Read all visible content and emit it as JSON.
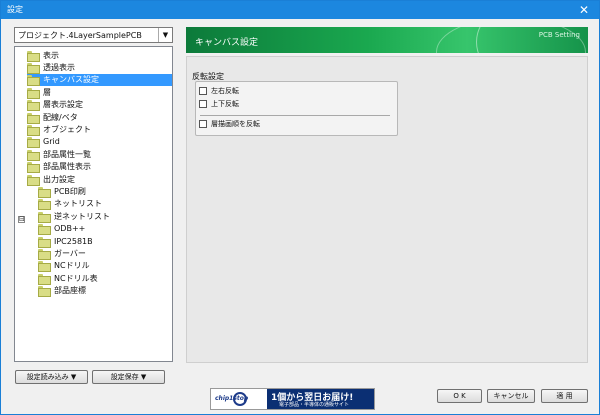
{
  "window": {
    "title": "設定",
    "close_glyph": "✕"
  },
  "project_combo": {
    "value": "プロジェクト.4LayerSamplePCB",
    "arrow": "▼"
  },
  "tree": {
    "expander_glyph": "⊟",
    "items": [
      {
        "label": "表示",
        "level": 0
      },
      {
        "label": "透過表示",
        "level": 0
      },
      {
        "label": "キャンバス設定",
        "level": 0,
        "selected": true
      },
      {
        "label": "層",
        "level": 0
      },
      {
        "label": "層表示設定",
        "level": 0
      },
      {
        "label": "配線/ベタ",
        "level": 0
      },
      {
        "label": "オブジェクト",
        "level": 0
      },
      {
        "label": "Grid",
        "level": 0
      },
      {
        "label": "部品属性一覧",
        "level": 0
      },
      {
        "label": "部品属性表示",
        "level": 0
      },
      {
        "label": "出力設定",
        "level": 0,
        "expanded": true
      },
      {
        "label": "PCB印刷",
        "level": 1
      },
      {
        "label": "ネットリスト",
        "level": 1
      },
      {
        "label": "逆ネットリスト",
        "level": 1
      },
      {
        "label": "ODB++",
        "level": 1
      },
      {
        "label": "IPC2581B",
        "level": 1
      },
      {
        "label": "ガーバー",
        "level": 1
      },
      {
        "label": "NCドリル",
        "level": 1
      },
      {
        "label": "NCドリル表",
        "level": 1
      },
      {
        "label": "部品座標",
        "level": 1
      }
    ]
  },
  "left_buttons": {
    "load": "設定読み込み ▼",
    "save": "設定保存 ▼"
  },
  "header": {
    "title": "キャンバス設定",
    "right_text": "PCB Setting"
  },
  "flip": {
    "group_label": "反転設定",
    "options": [
      {
        "label": "左右反転",
        "checked": false
      },
      {
        "label": "上下反転",
        "checked": false
      },
      {
        "label": "層描画順を反転",
        "checked": false
      }
    ]
  },
  "banner": {
    "logo": "chip1stop",
    "headline": "1個から翌日お届け!",
    "sub": "電子部品・半導体の通販サイト"
  },
  "dialog_buttons": {
    "ok": "O K",
    "cancel": "キャンセル",
    "apply": "適 用"
  }
}
